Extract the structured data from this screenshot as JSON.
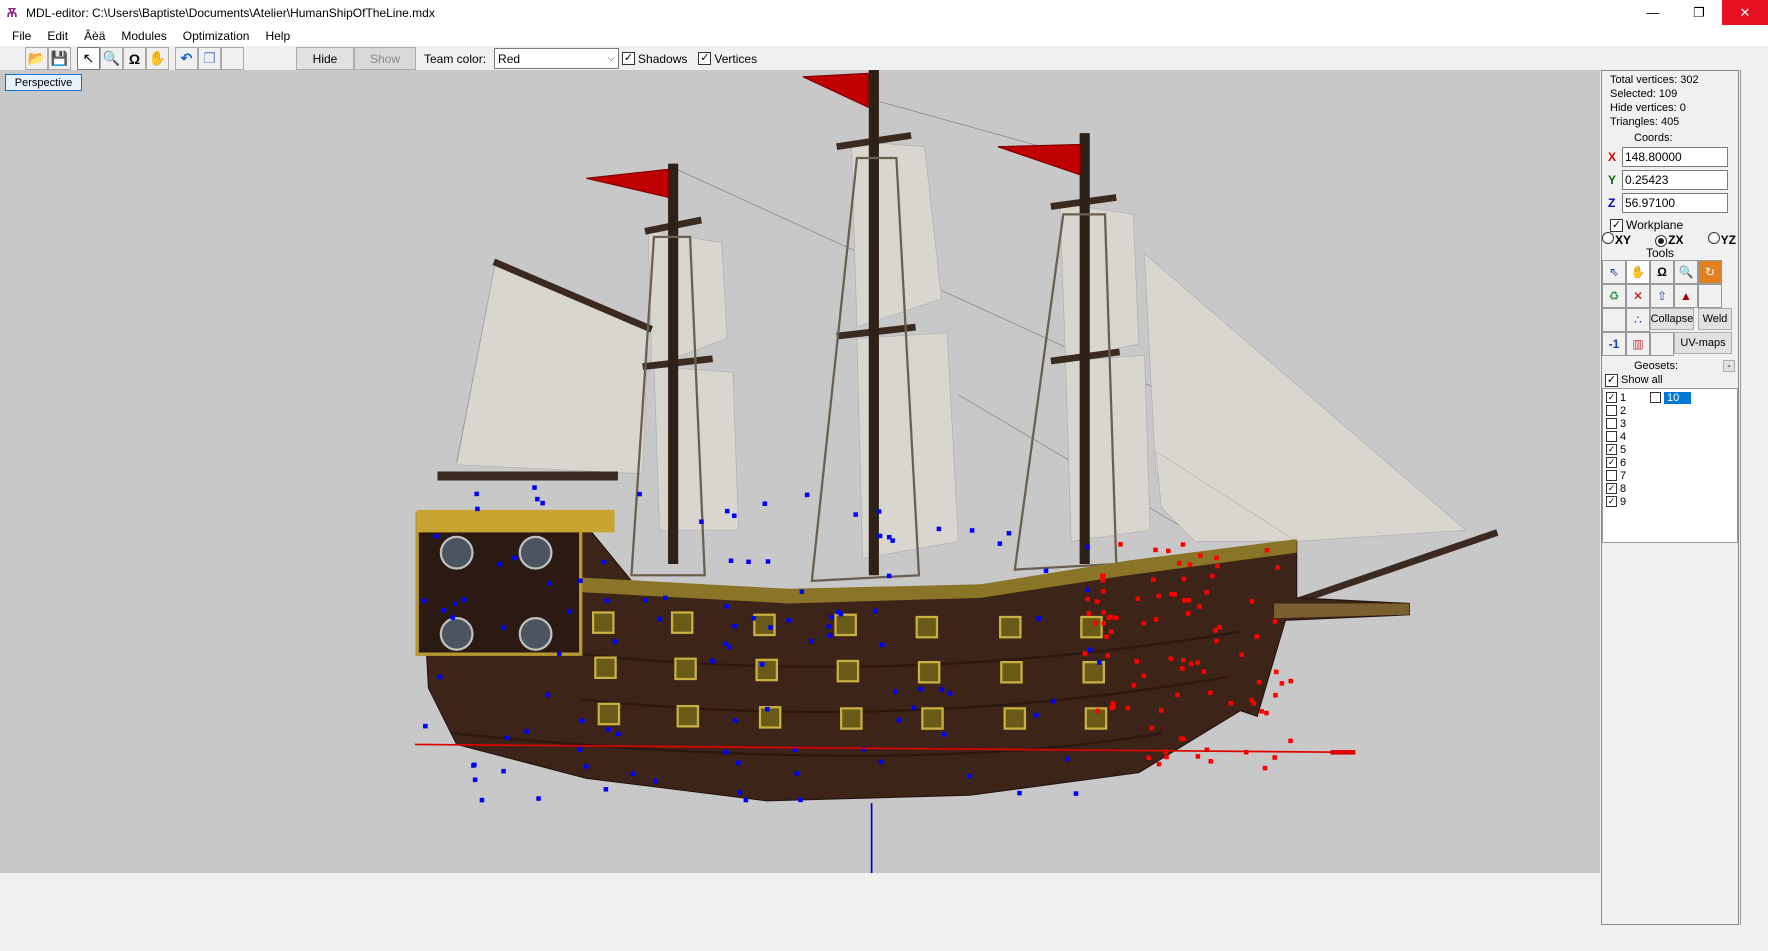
{
  "window": {
    "title": "MDL-editor: C:\\Users\\Baptiste\\Documents\\Atelier\\HumanShipOfTheLine.mdx",
    "minimize": "—",
    "restore": "❐",
    "close": "✕"
  },
  "menu": [
    "File",
    "Edit",
    "Âèä",
    "Modules",
    "Optimization",
    "Help"
  ],
  "toolbar": {
    "hide_label": "Hide",
    "show_label": "Show",
    "team_color_label": "Team color:",
    "team_color_value": "Red",
    "shadows_label": "Shadows",
    "shadows_checked": true,
    "vertices_label": "Vertices",
    "vertices_checked": true
  },
  "viewport": {
    "mode_label": "Perspective"
  },
  "panel": {
    "total_vertices": "Total vertices: 302",
    "selected": "Selected: 109",
    "hide_vertices": "Hide vertices: 0",
    "triangles": "Triangles: 405",
    "coords_label": "Coords:",
    "x_label": "X",
    "x_value": "148.80000",
    "y_label": "Y",
    "y_value": "0.25423",
    "z_label": "Z",
    "z_value": "56.97100",
    "workplane_label": "Workplane",
    "workplane_checked": true,
    "planes": [
      {
        "label": "XY",
        "selected": false
      },
      {
        "label": "ZX",
        "selected": true
      },
      {
        "label": "YZ",
        "selected": false
      }
    ],
    "tools_label": "Tools",
    "collapse_label": "Collapse",
    "weld_label": "Weld",
    "minus_one_label": "-1",
    "uvmaps_label": "UV-maps",
    "geosets_label": "Geosets:",
    "geosets_collapse": "-",
    "show_all_label": "Show all",
    "geosets": [
      {
        "label": "1",
        "checked": true
      },
      {
        "label": "2",
        "checked": false
      },
      {
        "label": "3",
        "checked": false
      },
      {
        "label": "4",
        "checked": false
      },
      {
        "label": "5",
        "checked": true
      },
      {
        "label": "6",
        "checked": true
      },
      {
        "label": "7",
        "checked": false
      },
      {
        "label": "8",
        "checked": true
      },
      {
        "label": "9",
        "checked": true
      },
      {
        "label": "10",
        "checked": false
      }
    ]
  },
  "colors": {
    "x_axis": "#d00000",
    "y_axis": "#007000",
    "z_axis": "#0000c0",
    "selection": "#0078d7",
    "viewport_bg": "#c8c8c8"
  }
}
